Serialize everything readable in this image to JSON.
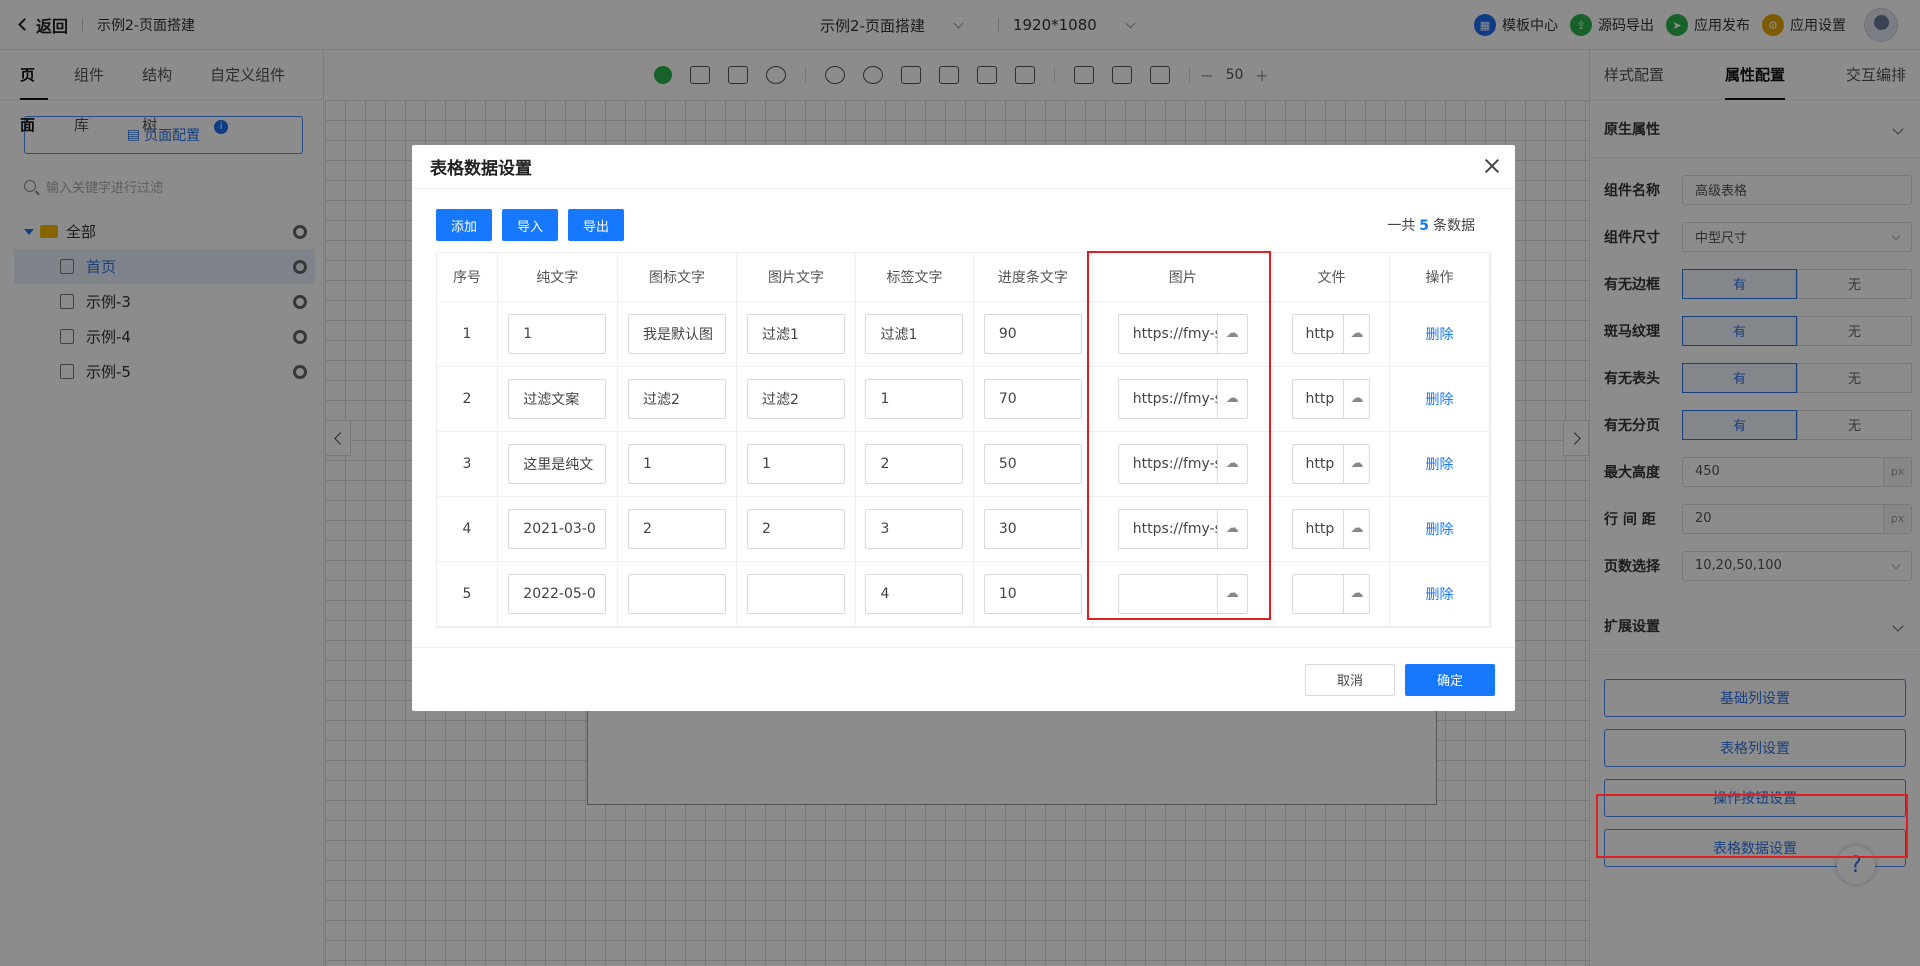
{
  "header": {
    "back_label": "返回",
    "project_name": "示例2-页面搭建",
    "page_select": "示例2-页面搭建",
    "resolution": "1920*1080",
    "actions": [
      {
        "label": "模板中心",
        "color": "#1d6ef0",
        "icon": "template-icon"
      },
      {
        "label": "源码导出",
        "color": "#2bb34a",
        "icon": "export-icon"
      },
      {
        "label": "应用发布",
        "color": "#2bb34a",
        "icon": "publish-icon"
      },
      {
        "label": "应用设置",
        "color": "#e6a700",
        "icon": "settings-icon"
      }
    ]
  },
  "left": {
    "tabs": [
      "页面",
      "组件库",
      "结构树",
      "自定义组件"
    ],
    "page_config": "页面配置",
    "filter_placeholder": "输入关键字进行过滤",
    "tree": {
      "root": "全部",
      "pages": [
        "首页",
        "示例-3",
        "示例-4",
        "示例-5"
      ]
    }
  },
  "toolbar": {
    "zoom": "50"
  },
  "right": {
    "tabs": [
      "样式配置",
      "属性配置",
      "交互编排"
    ],
    "section_native": "原生属性",
    "props": {
      "name_label": "组件名称",
      "name_value": "高级表格",
      "size_label": "组件尺寸",
      "size_value": "中型尺寸",
      "border_label": "有无边框",
      "stripe_label": "斑马纹理",
      "header_label": "有无表头",
      "pager_label": "有无分页",
      "yes": "有",
      "no": "无",
      "maxh_label": "最大高度",
      "maxh_value": "450",
      "rowgap_label": "行 间 距",
      "rowgap_value": "20",
      "unit": "px",
      "pages_label": "页数选择",
      "pages_value": "10,20,50,100"
    },
    "section_ext": "扩展设置",
    "ext_buttons": [
      "基础列设置",
      "表格列设置",
      "操作按钮设置",
      "表格数据设置"
    ]
  },
  "modal": {
    "title": "表格数据设置",
    "add": "添加",
    "import": "导入",
    "export": "导出",
    "total_prefix": "一共",
    "total_count": "5",
    "total_suffix": "条数据",
    "columns": [
      "序号",
      "纯文字",
      "图标文字",
      "图片文字",
      "标签文字",
      "进度条文字",
      "图片",
      "文件",
      "操作"
    ],
    "rows": [
      {
        "no": "1",
        "text": "1",
        "icon": "我是默认图",
        "img": "过滤1",
        "tag": "过滤1",
        "prog": "90",
        "pic": "https://fmy-s",
        "file": "http",
        "op": "删除"
      },
      {
        "no": "2",
        "text": "过滤文案",
        "icon": "过滤2",
        "img": "过滤2",
        "tag": "1",
        "prog": "70",
        "pic": "https://fmy-s",
        "file": "http",
        "op": "删除"
      },
      {
        "no": "3",
        "text": "这里是纯文",
        "icon": "1",
        "img": "1",
        "tag": "2",
        "prog": "50",
        "pic": "https://fmy-s",
        "file": "http",
        "op": "删除"
      },
      {
        "no": "4",
        "text": "2021-03-0",
        "icon": "2",
        "img": "2",
        "tag": "3",
        "prog": "30",
        "pic": "https://fmy-s",
        "file": "http",
        "op": "删除"
      },
      {
        "no": "5",
        "text": "2022-05-0",
        "icon": "",
        "img": "",
        "tag": "4",
        "prog": "10",
        "pic": "",
        "file": "",
        "op": "删除"
      }
    ],
    "cancel": "取消",
    "confirm": "确定"
  },
  "help": "?"
}
